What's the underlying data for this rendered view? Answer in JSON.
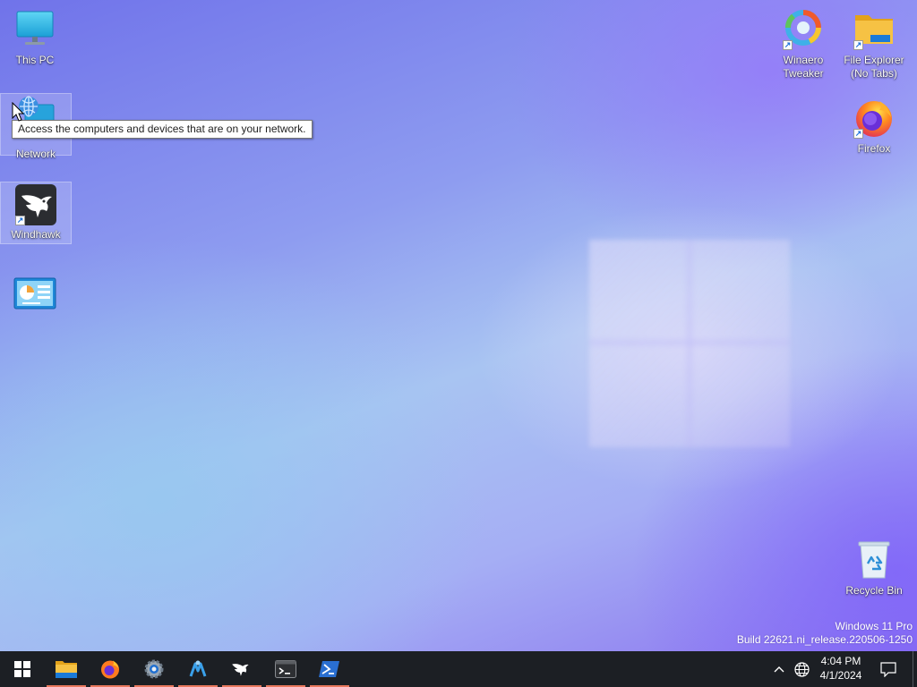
{
  "desktop": {
    "icons": {
      "this_pc": {
        "label": "This PC",
        "icon": "monitor-icon"
      },
      "network": {
        "label": "Network",
        "icon": "network-icon"
      },
      "windhawk": {
        "label": "Windhawk",
        "icon": "windhawk-eagle-icon"
      },
      "control_panel": {
        "label": "",
        "icon": "control-panel-icon"
      },
      "winaero": {
        "label_line1": "Winaero",
        "label_line2": "Tweaker",
        "icon": "winaero-tweaker-icon"
      },
      "file_explorer": {
        "label_line1": "File Explorer",
        "label_line2": "(No Tabs)",
        "icon": "folder-icon"
      },
      "firefox": {
        "label": "Firefox",
        "icon": "firefox-icon"
      },
      "recycle_bin": {
        "label": "Recycle Bin",
        "icon": "recycle-bin-icon"
      }
    },
    "tooltip": "Access the computers and devices that are on your network.",
    "watermark": {
      "line1": "Windows 11 Pro",
      "line2": "Build 22621.ni_release.220506-1250"
    }
  },
  "taskbar": {
    "apps": [
      {
        "name": "start",
        "icon": "windows-start-icon",
        "running": false
      },
      {
        "name": "file-explorer",
        "icon": "folder-icon",
        "running": true
      },
      {
        "name": "firefox",
        "icon": "firefox-icon",
        "running": true
      },
      {
        "name": "settings",
        "icon": "gear-icon",
        "running": true
      },
      {
        "name": "winaero",
        "icon": "winaero-tweaker-icon",
        "running": true
      },
      {
        "name": "windhawk",
        "icon": "windhawk-eagle-icon",
        "running": true
      },
      {
        "name": "terminal",
        "icon": "terminal-icon",
        "running": true
      },
      {
        "name": "powershell",
        "icon": "powershell-icon",
        "running": true
      }
    ],
    "tray": {
      "chevron_icon": "chevron-up-icon",
      "network_icon": "globe-icon",
      "notification_icon": "notification-icon"
    },
    "clock": {
      "time": "4:04 PM",
      "date": "4/1/2024"
    }
  },
  "colors": {
    "taskbar_bg": "#1c1f24",
    "running_indicator": "#e8785d",
    "folder_yellow": "#f6c244",
    "accent_blue": "#1a6fd9"
  }
}
